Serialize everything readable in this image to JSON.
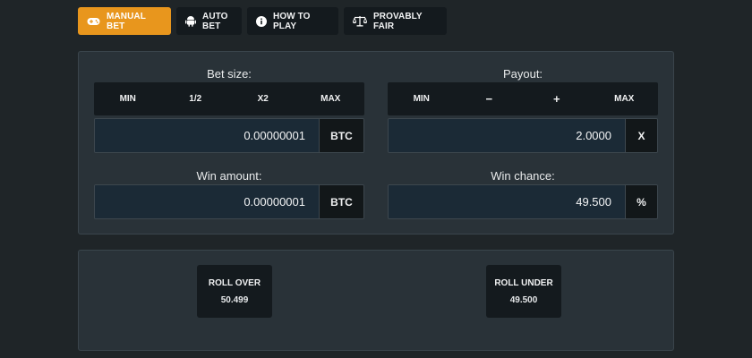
{
  "tabs": [
    {
      "label": "MANUAL BET",
      "icon": "gamepad-icon",
      "active": true
    },
    {
      "label": "AUTO BET",
      "icon": "android-icon",
      "active": false
    },
    {
      "label": "HOW TO PLAY",
      "icon": "info-icon",
      "active": false
    },
    {
      "label": "PROVABLY FAIR",
      "icon": "scale-icon",
      "active": false
    }
  ],
  "bet_size": {
    "label": "Bet size:",
    "buttons": [
      "MIN",
      "1/2",
      "X2",
      "MAX"
    ],
    "value": "0.00000001",
    "unit": "BTC"
  },
  "payout": {
    "label": "Payout:",
    "buttons": [
      "MIN",
      "−",
      "+",
      "MAX"
    ],
    "value": "2.0000",
    "unit": "X"
  },
  "win_amount": {
    "label": "Win amount:",
    "value": "0.00000001",
    "unit": "BTC"
  },
  "win_chance": {
    "label": "Win chance:",
    "value": "49.500",
    "unit": "%"
  },
  "roll_over": {
    "label": "ROLL OVER",
    "value": "50.499"
  },
  "roll_under": {
    "label": "ROLL UNDER",
    "value": "49.500"
  },
  "colors": {
    "accent": "#e8961d",
    "background": "#1f2528",
    "panel": "#293238"
  }
}
